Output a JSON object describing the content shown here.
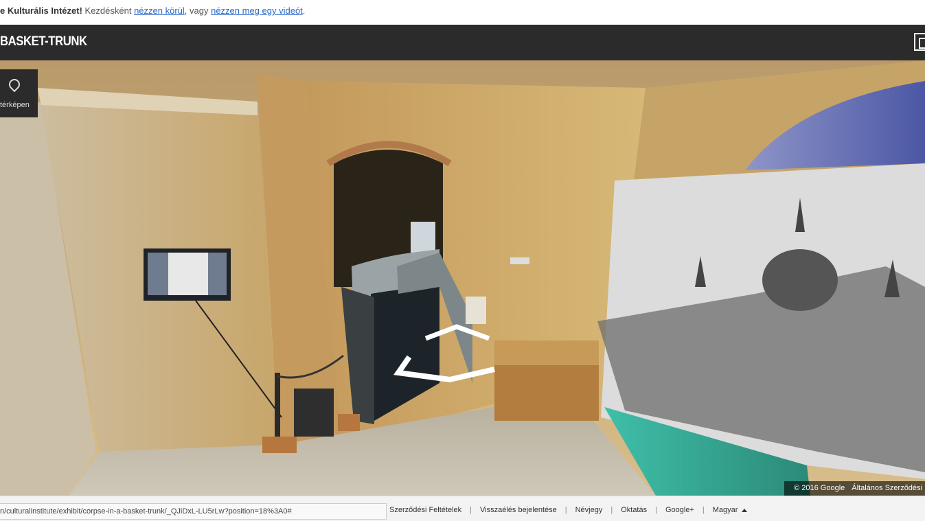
{
  "top_notice": {
    "institute": "e Kulturális Intézet!",
    "text1": " Kezdésként ",
    "link1": "nézzen körül",
    "text2": ", vagy ",
    "link2": "nézzen meg egy videót",
    "text3": "."
  },
  "header": {
    "title": "BASKET-TRUNK"
  },
  "viewer": {
    "map_button_label": "térképen",
    "copyright": "© 2016 Google",
    "terms": "Általános Szerződési"
  },
  "footer": {
    "url": "n/culturalinstitute/exhibit/corpse-in-a-basket-trunk/_QJiDxL-LU5rLw?position=18%3A0#",
    "links": [
      "Szerződési Feltételek",
      "Visszaélés bejelentése",
      "Névjegy",
      "Oktatás",
      "Google+",
      "Magyar"
    ]
  },
  "colors": {
    "header_bg": "#2b2b2b",
    "link": "#2a66c9"
  }
}
